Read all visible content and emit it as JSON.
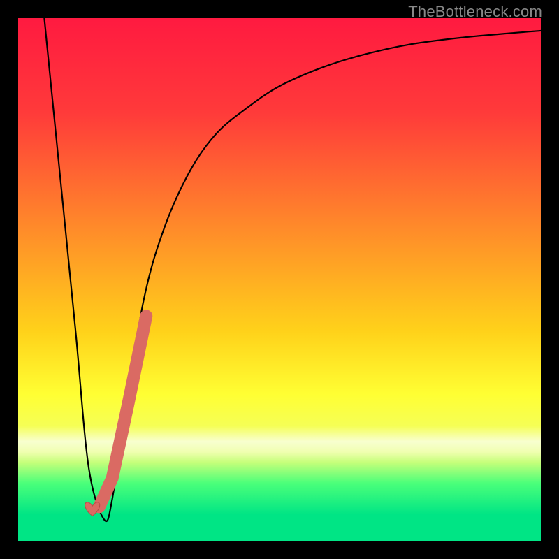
{
  "watermark": {
    "text": "TheBottleneck.com"
  },
  "colors": {
    "frame": "#000000",
    "curve": "#000000",
    "marker_fill": "#da6a63",
    "marker_stroke": "#b74c46",
    "gradient_stops": [
      {
        "offset": "0%",
        "color": "#ff1a40"
      },
      {
        "offset": "18%",
        "color": "#ff3a3a"
      },
      {
        "offset": "40%",
        "color": "#ff8a2a"
      },
      {
        "offset": "60%",
        "color": "#ffd21a"
      },
      {
        "offset": "72%",
        "color": "#ffff33"
      },
      {
        "offset": "78%",
        "color": "#f5ff55"
      },
      {
        "offset": "81%",
        "color": "#f8ffd0"
      },
      {
        "offset": "83%",
        "color": "#f0ffb0"
      },
      {
        "offset": "85%",
        "color": "#c5ff7a"
      },
      {
        "offset": "89%",
        "color": "#4aff7a"
      },
      {
        "offset": "95%",
        "color": "#00e585"
      },
      {
        "offset": "100%",
        "color": "#00e585"
      }
    ]
  },
  "chart_data": {
    "type": "line",
    "title": "",
    "xlabel": "",
    "ylabel": "",
    "xlim": [
      0,
      100
    ],
    "ylim": [
      0,
      100
    ],
    "series": [
      {
        "name": "bottleneck-curve",
        "x": [
          5,
          8,
          11,
          13.5,
          16.5,
          18,
          20,
          24,
          28,
          33,
          38,
          44,
          50,
          58,
          66,
          75,
          85,
          95,
          100
        ],
        "y": [
          100,
          70,
          40,
          14,
          4,
          8,
          22,
          46,
          60,
          71,
          78,
          83,
          87,
          90.5,
          93,
          95,
          96.3,
          97.2,
          97.6
        ]
      }
    ],
    "markers": {
      "name": "highlight-segment",
      "heart_point": {
        "x": 14.2,
        "y": 5.5
      },
      "stroke_points": [
        {
          "x": 15.5,
          "y": 6.5
        },
        {
          "x": 18.0,
          "y": 12.0
        },
        {
          "x": 21.0,
          "y": 26.0
        },
        {
          "x": 24.5,
          "y": 43.0
        }
      ]
    }
  }
}
